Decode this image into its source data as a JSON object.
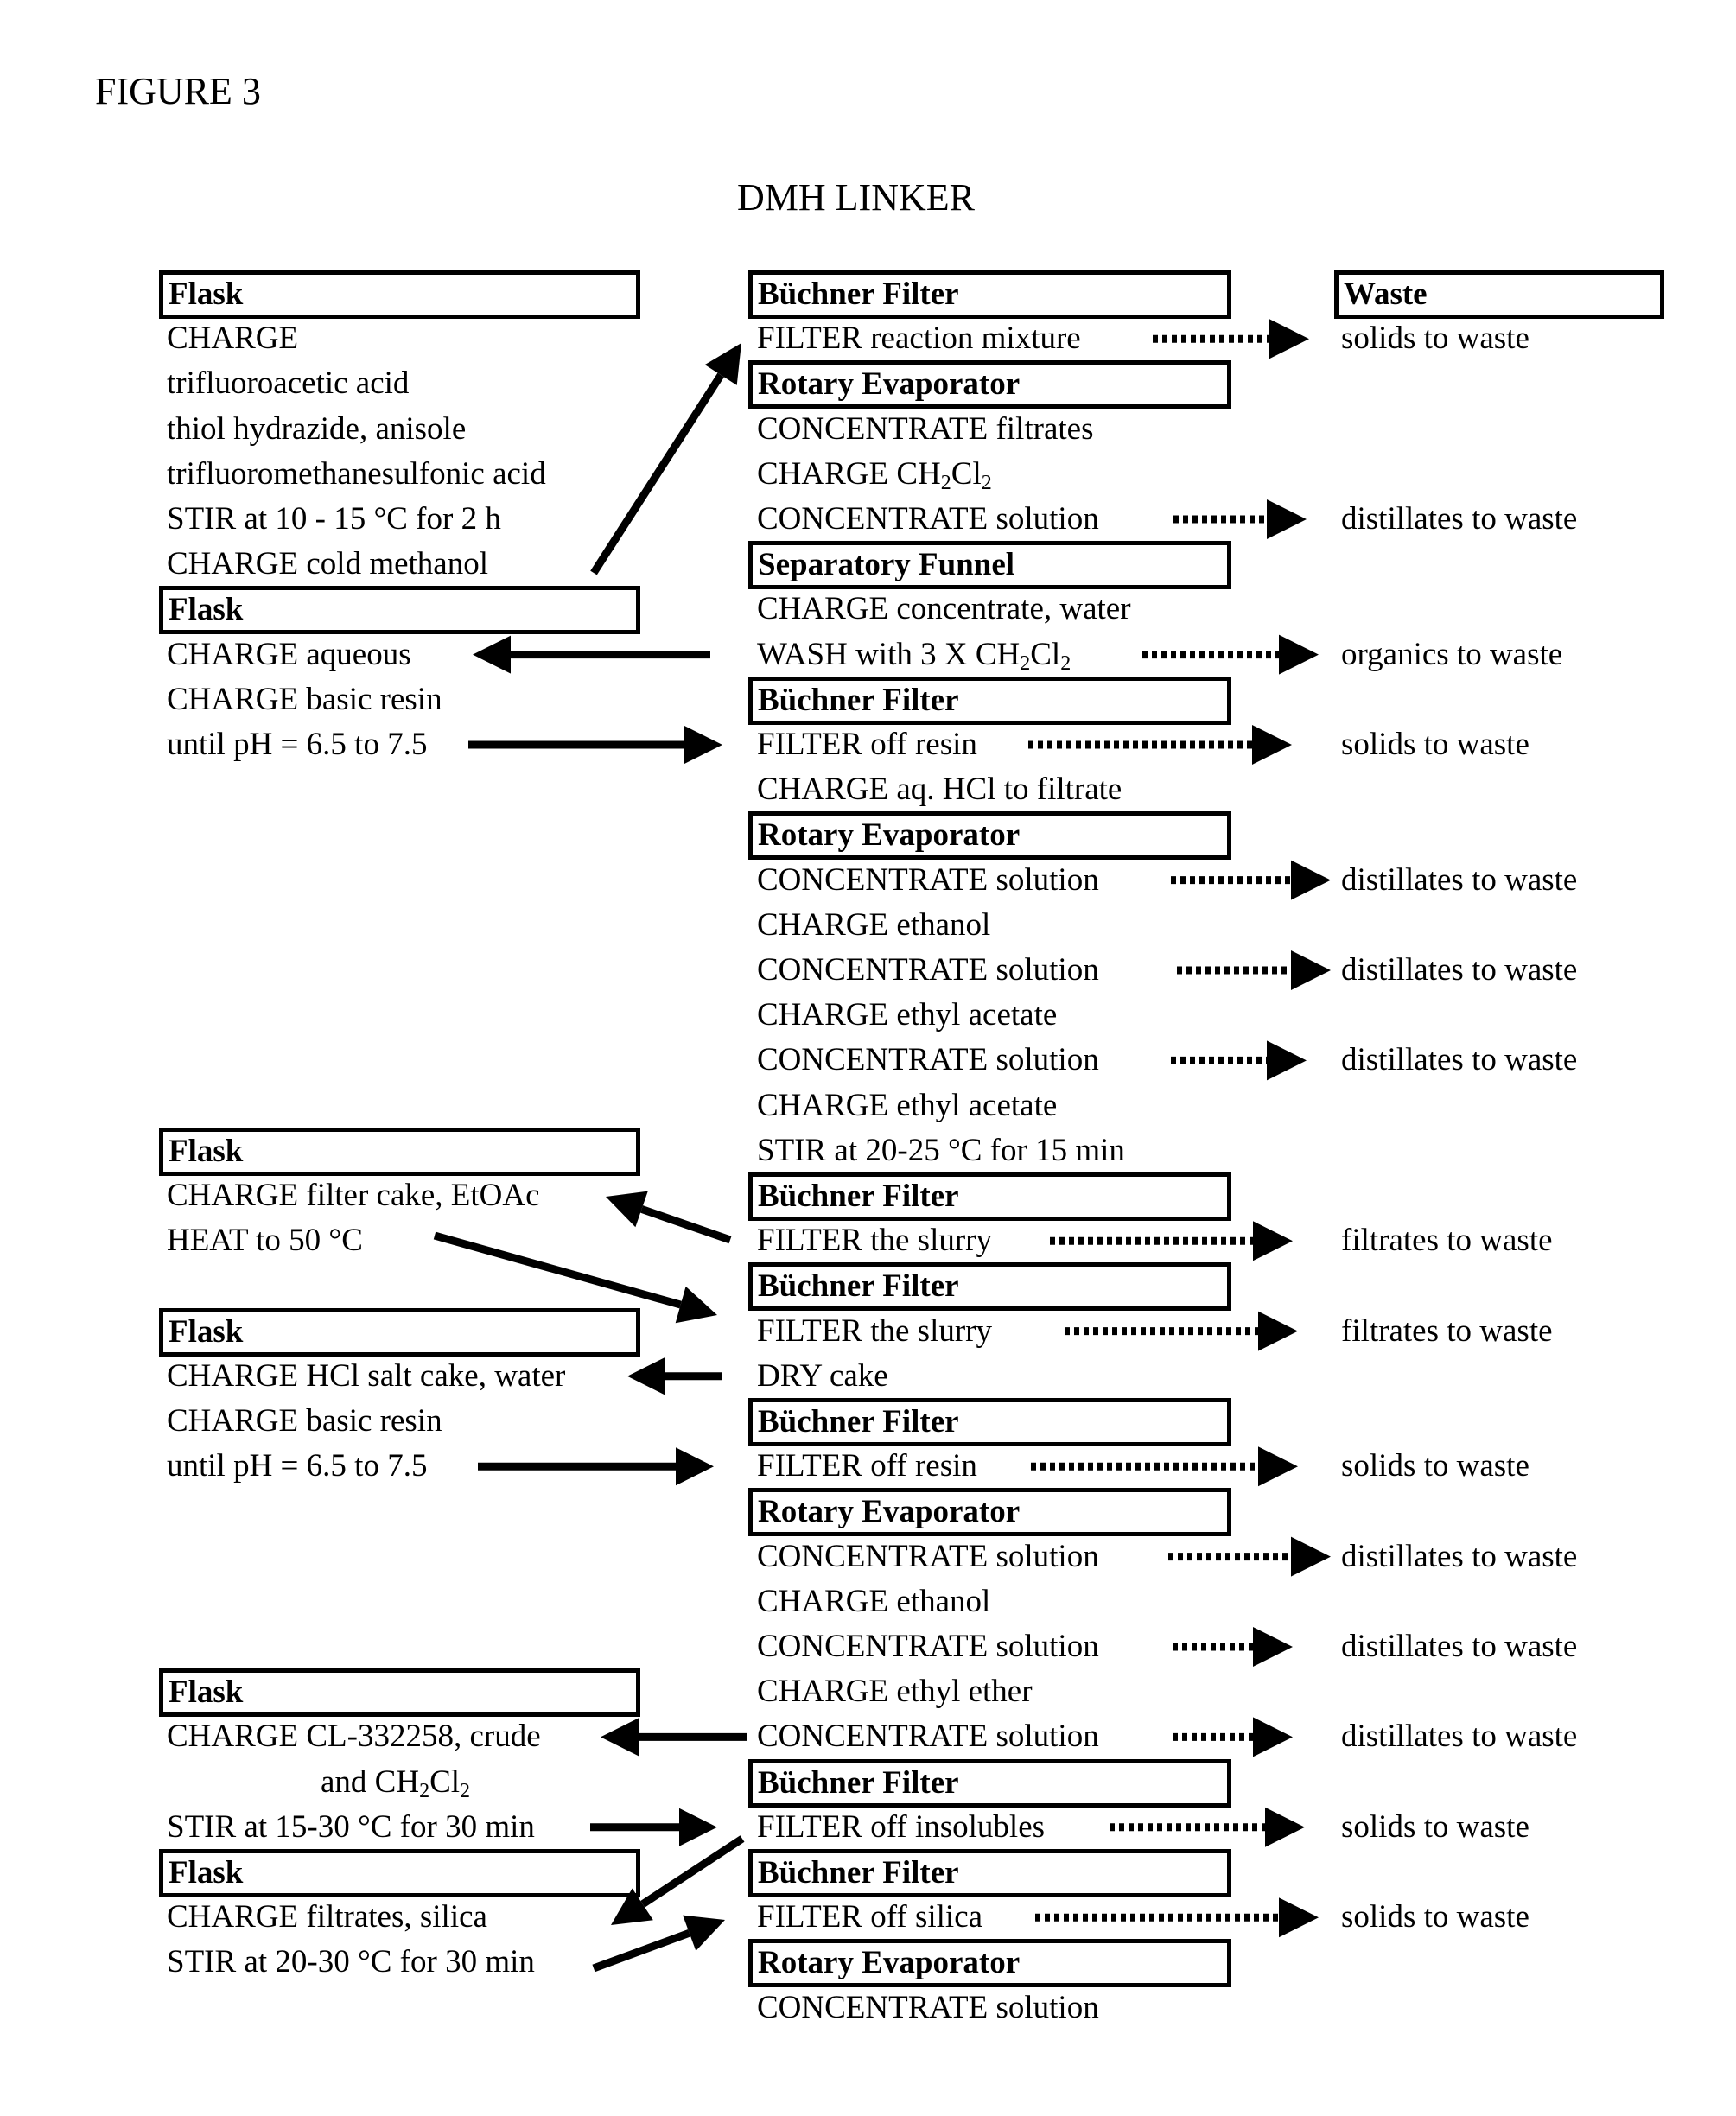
{
  "figure_label": "FIGURE 3",
  "title": "DMH LINKER",
  "left_column": [
    {
      "row": 0,
      "type": "box",
      "text": "Flask"
    },
    {
      "row": 1,
      "type": "step",
      "text": "CHARGE"
    },
    {
      "row": 2,
      "type": "step",
      "text": "trifluoroacetic acid"
    },
    {
      "row": 3,
      "type": "step",
      "text": "thiol hydrazide, anisole"
    },
    {
      "row": 4,
      "type": "step",
      "text": "trifluoromethanesulfonic acid"
    },
    {
      "row": 5,
      "type": "step",
      "text": "STIR at 10 - 15 °C for 2 h"
    },
    {
      "row": 6,
      "type": "step",
      "text": "CHARGE cold methanol"
    },
    {
      "row": 7,
      "type": "box",
      "text": "Flask"
    },
    {
      "row": 8,
      "type": "step",
      "text": "CHARGE aqueous"
    },
    {
      "row": 9,
      "type": "step",
      "text": "CHARGE basic resin"
    },
    {
      "row": 10,
      "type": "step",
      "text": "until pH = 6.5 to 7.5"
    },
    {
      "row": 19,
      "type": "box",
      "text": "Flask"
    },
    {
      "row": 20,
      "type": "step",
      "text": "CHARGE filter cake, EtOAc"
    },
    {
      "row": 21,
      "type": "step",
      "text": "HEAT to 50 °C"
    },
    {
      "row": 23,
      "type": "box",
      "text": "Flask"
    },
    {
      "row": 24,
      "type": "step",
      "text": "CHARGE HCl salt cake, water"
    },
    {
      "row": 25,
      "type": "step",
      "text": "CHARGE basic resin"
    },
    {
      "row": 26,
      "type": "step",
      "text": "until pH = 6.5 to 7.5"
    },
    {
      "row": 31,
      "type": "box",
      "text": "Flask"
    },
    {
      "row": 32,
      "type": "step",
      "text": "CHARGE CL-332258, crude"
    },
    {
      "row": 33,
      "type": "step",
      "text": "and CH2Cl2",
      "indent": true,
      "parts": [
        "and CH",
        "2",
        "Cl",
        "2"
      ]
    },
    {
      "row": 34,
      "type": "step",
      "text": "STIR at 15-30 °C for 30 min"
    },
    {
      "row": 35,
      "type": "box",
      "text": "Flask"
    },
    {
      "row": 36,
      "type": "step",
      "text": "CHARGE filtrates, silica"
    },
    {
      "row": 37,
      "type": "step",
      "text": "STIR at 20-30 °C for 30 min"
    }
  ],
  "middle_column": [
    {
      "row": 0,
      "type": "box",
      "text": "Büchner Filter"
    },
    {
      "row": 1,
      "type": "step",
      "text": "FILTER reaction mixture"
    },
    {
      "row": 2,
      "type": "box",
      "text": "Rotary Evaporator"
    },
    {
      "row": 3,
      "type": "step",
      "text": "CONCENTRATE filtrates"
    },
    {
      "row": 4,
      "type": "step",
      "text": "CHARGE CH2Cl2",
      "parts": [
        "CHARGE CH",
        "2",
        "Cl",
        "2"
      ]
    },
    {
      "row": 5,
      "type": "step",
      "text": "CONCENTRATE solution"
    },
    {
      "row": 6,
      "type": "box",
      "text": "Separatory Funnel"
    },
    {
      "row": 7,
      "type": "step",
      "text": "CHARGE concentrate, water"
    },
    {
      "row": 8,
      "type": "step",
      "text": "WASH with 3 X CH2Cl2",
      "parts": [
        "WASH with 3 X CH",
        "2",
        "Cl",
        "2"
      ]
    },
    {
      "row": 9,
      "type": "box",
      "text": "Büchner Filter"
    },
    {
      "row": 10,
      "type": "step",
      "text": "FILTER off resin"
    },
    {
      "row": 11,
      "type": "step",
      "text": "CHARGE aq. HCl to filtrate"
    },
    {
      "row": 12,
      "type": "box",
      "text": "Rotary Evaporator"
    },
    {
      "row": 13,
      "type": "step",
      "text": "CONCENTRATE solution"
    },
    {
      "row": 14,
      "type": "step",
      "text": "CHARGE ethanol"
    },
    {
      "row": 15,
      "type": "step",
      "text": "CONCENTRATE solution"
    },
    {
      "row": 16,
      "type": "step",
      "text": "CHARGE ethyl acetate"
    },
    {
      "row": 17,
      "type": "step",
      "text": "CONCENTRATE solution"
    },
    {
      "row": 18,
      "type": "step",
      "text": "CHARGE ethyl acetate"
    },
    {
      "row": 19,
      "type": "step",
      "text": "STIR at 20-25 °C for 15 min"
    },
    {
      "row": 20,
      "type": "box",
      "text": "Büchner Filter"
    },
    {
      "row": 21,
      "type": "step",
      "text": "FILTER the slurry"
    },
    {
      "row": 22,
      "type": "box",
      "text": "Büchner Filter"
    },
    {
      "row": 23,
      "type": "step",
      "text": "FILTER the slurry"
    },
    {
      "row": 24,
      "type": "step",
      "text": "DRY cake"
    },
    {
      "row": 25,
      "type": "box",
      "text": "Büchner Filter"
    },
    {
      "row": 26,
      "type": "step",
      "text": "FILTER off resin"
    },
    {
      "row": 27,
      "type": "box",
      "text": "Rotary Evaporator"
    },
    {
      "row": 28,
      "type": "step",
      "text": "CONCENTRATE solution"
    },
    {
      "row": 29,
      "type": "step",
      "text": "CHARGE ethanol"
    },
    {
      "row": 30,
      "type": "step",
      "text": "CONCENTRATE solution"
    },
    {
      "row": 31,
      "type": "step",
      "text": "CHARGE ethyl ether"
    },
    {
      "row": 32,
      "type": "step",
      "text": "CONCENTRATE solution"
    },
    {
      "row": 33,
      "type": "box",
      "text": "Büchner Filter"
    },
    {
      "row": 34,
      "type": "step",
      "text": "FILTER off insolubles"
    },
    {
      "row": 35,
      "type": "box",
      "text": "Büchner Filter"
    },
    {
      "row": 36,
      "type": "step",
      "text": "FILTER off silica"
    },
    {
      "row": 37,
      "type": "box",
      "text": "Rotary Evaporator"
    },
    {
      "row": 38,
      "type": "step",
      "text": "CONCENTRATE solution"
    }
  ],
  "waste_column": [
    {
      "row": 0,
      "type": "box",
      "text": "Waste"
    },
    {
      "row": 1,
      "type": "step",
      "text": "solids to waste"
    },
    {
      "row": 5,
      "type": "step",
      "text": "distillates to waste"
    },
    {
      "row": 8,
      "type": "step",
      "text": "organics  to waste"
    },
    {
      "row": 10,
      "type": "step",
      "text": "solids to waste"
    },
    {
      "row": 13,
      "type": "step",
      "text": "distillates to waste"
    },
    {
      "row": 15,
      "type": "step",
      "text": "distillates to waste"
    },
    {
      "row": 17,
      "type": "step",
      "text": "distillates to waste"
    },
    {
      "row": 21,
      "type": "step",
      "text": "filtrates to waste"
    },
    {
      "row": 23,
      "type": "step",
      "text": "filtrates to waste"
    },
    {
      "row": 26,
      "type": "step",
      "text": "solids to waste"
    },
    {
      "row": 28,
      "type": "step",
      "text": "distillates to waste"
    },
    {
      "row": 30,
      "type": "step",
      "text": "distillates to waste"
    },
    {
      "row": 32,
      "type": "step",
      "text": "distillates to waste"
    },
    {
      "row": 34,
      "type": "step",
      "text": "solids to waste"
    },
    {
      "row": 36,
      "type": "step",
      "text": "solids to waste"
    }
  ],
  "solid_arrows": [
    {
      "from": "left:CHARGE cold methanol",
      "to": "middle:FILTER reaction mixture",
      "direction": "up-right"
    },
    {
      "from": "middle:WASH with 3 X CH2Cl2",
      "to": "left:CHARGE aqueous",
      "direction": "left"
    },
    {
      "from": "left:until pH = 6.5 to 7.5",
      "to": "middle:FILTER off resin",
      "direction": "right"
    },
    {
      "from": "middle:FILTER the slurry",
      "to": "left:CHARGE filter cake, EtOAc",
      "direction": "up-left"
    },
    {
      "from": "left:HEAT to 50 °C",
      "to": "middle:FILTER the slurry",
      "direction": "down-right"
    },
    {
      "from": "middle:DRY cake",
      "to": "left:CHARGE HCl salt cake, water",
      "direction": "left"
    },
    {
      "from": "left:until pH = 6.5 to 7.5",
      "to": "middle:FILTER off resin",
      "direction": "right"
    },
    {
      "from": "middle:CONCENTRATE solution",
      "to": "left:CHARGE CL-332258, crude",
      "direction": "left"
    },
    {
      "from": "left:STIR at 15-30 °C for 30 min",
      "to": "middle:FILTER off insolubles",
      "direction": "right"
    },
    {
      "from": "middle:FILTER off insolubles",
      "to": "left:CHARGE filtrates, silica",
      "direction": "down-left"
    },
    {
      "from": "left:STIR at 20-30 °C for 30 min",
      "to": "middle:FILTER off silica",
      "direction": "up-right"
    }
  ],
  "dotted_arrow_rows": [
    1,
    5,
    8,
    10,
    13,
    15,
    17,
    21,
    23,
    26,
    28,
    30,
    32,
    34,
    36
  ]
}
